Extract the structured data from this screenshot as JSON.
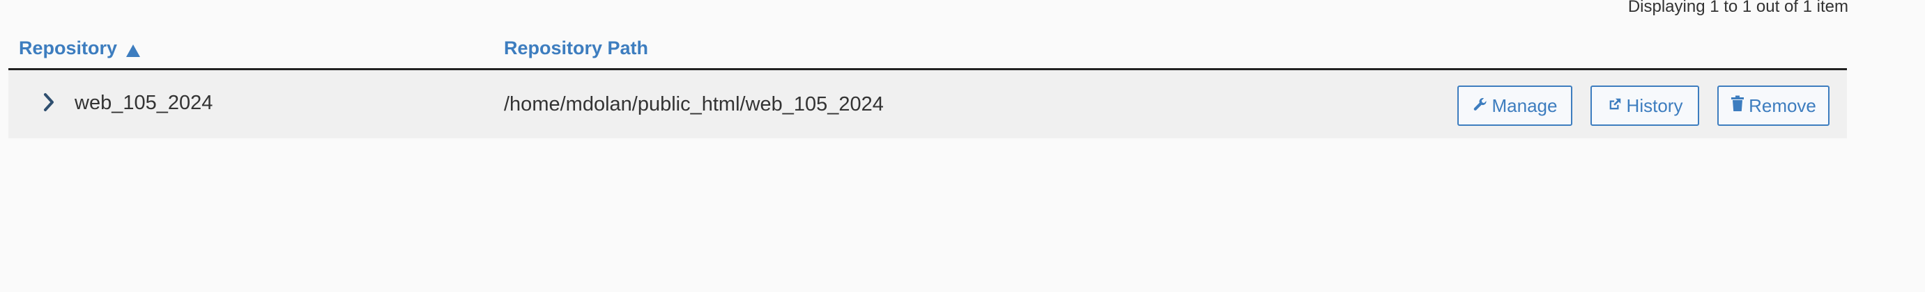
{
  "pagination": {
    "summary": "Displaying 1 to 1 out of 1 item"
  },
  "table": {
    "columns": [
      {
        "label": "Repository",
        "sort": "ascending"
      },
      {
        "label": "Repository Path"
      }
    ],
    "rows": [
      {
        "name": "web_105_2024",
        "path": "/home/mdolan/public_html/web_105_2024",
        "actions": {
          "manage": "Manage",
          "history": "History",
          "remove": "Remove"
        }
      }
    ]
  },
  "icons": {
    "sort": "triangle-up-icon",
    "expand": "chevron-right-icon",
    "manage": "wrench-icon",
    "history": "external-link-icon",
    "remove": "trash-icon"
  },
  "colors": {
    "accent": "#3d7dbf",
    "row_background": "#f0f0f0",
    "page_background": "#fafafa",
    "header_rule": "#222222"
  }
}
